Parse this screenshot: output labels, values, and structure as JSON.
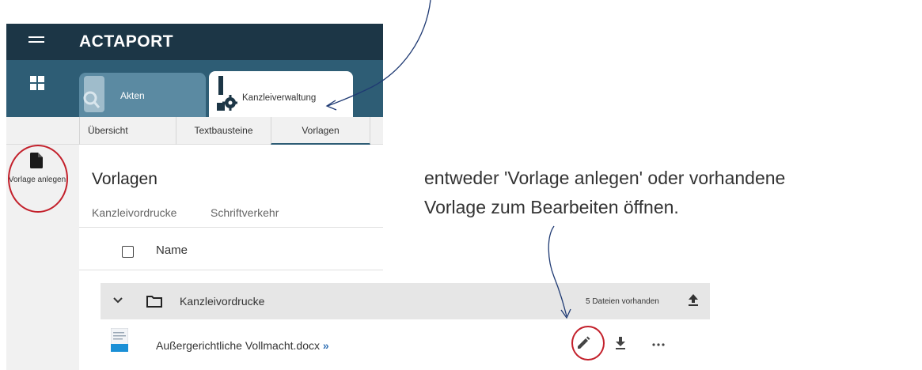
{
  "app": {
    "logo": "ACTAPORT"
  },
  "modules": {
    "akten_label": "Akten",
    "kanzlei_label": "Kanzleiverwaltung"
  },
  "subtabs": [
    {
      "label": "Übersicht"
    },
    {
      "label": "Textbausteine"
    },
    {
      "label": "Vorlagen",
      "active": true
    }
  ],
  "leftrail": {
    "new_template_label": "Vorlage anlegen"
  },
  "main": {
    "title": "Vorlagen",
    "categories": [
      "Kanzleivordrucke",
      "Schriftverkehr"
    ],
    "column_name": "Name"
  },
  "group": {
    "name": "Kanzleivordrucke",
    "count_text": "5 Dateien vorhanden"
  },
  "file": {
    "name": "Außergerichtliche Vollmacht.docx",
    "arrow": "»"
  },
  "annotation": {
    "line1": "entweder 'Vorlage anlegen' oder vorhandene",
    "line2": "Vorlage zum Bearbeiten öffnen."
  },
  "icons": {
    "menu": "menu-icon",
    "dashboard": "dashboard-icon",
    "search": "search-icon",
    "gear": "gear-icon",
    "document": "document-icon",
    "chevron": "chevron-down-icon",
    "folder": "folder-icon",
    "upload": "upload-icon",
    "edit": "pencil-icon",
    "download": "download-icon",
    "more": "more-icon"
  },
  "colors": {
    "topbar": "#1c3646",
    "moduleband": "#2e5d75",
    "highlight": "#c3202b",
    "annotation_arrow": "#1f3a73"
  }
}
